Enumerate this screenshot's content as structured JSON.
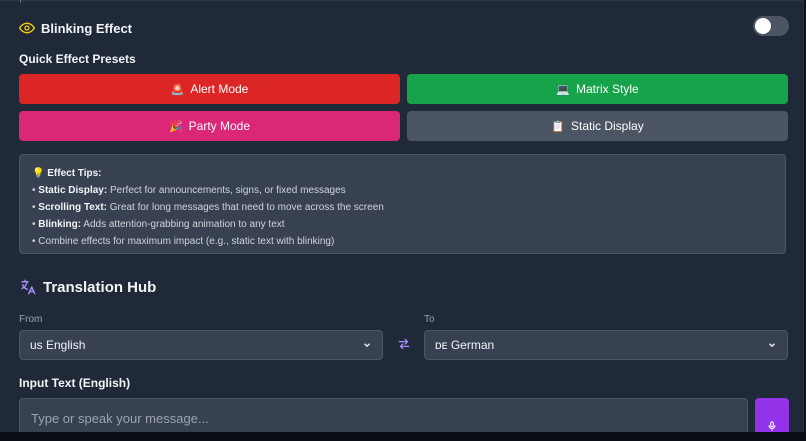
{
  "blink": {
    "title": "Blinking Effect",
    "enabled": false
  },
  "presets": {
    "label": "Quick Effect Presets",
    "items": [
      {
        "label": "Alert Mode",
        "icon": "🚨",
        "color": "#dc2626"
      },
      {
        "label": "Matrix Style",
        "icon": "💻",
        "color": "#16a34a"
      },
      {
        "label": "Party Mode",
        "icon": "🎉",
        "color": "#db2777"
      },
      {
        "label": "Static Display",
        "icon": "📋",
        "color": "#4b5563"
      }
    ]
  },
  "tips": {
    "heading": "Effect Tips:",
    "icon": "💡",
    "items": [
      {
        "bold": "Static Display:",
        "text": " Perfect for announcements, signs, or fixed messages"
      },
      {
        "bold": "Scrolling Text:",
        "text": " Great for long messages that need to move across the screen"
      },
      {
        "bold": "Blinking:",
        "text": " Adds attention-grabbing animation to any text"
      },
      {
        "bold": "",
        "text": "Combine effects for maximum impact (e.g., static text with blinking)"
      }
    ]
  },
  "translation": {
    "title": "Translation Hub",
    "from_label": "From",
    "to_label": "To",
    "from_value": "us English",
    "to_value": "ᴅᴇ German",
    "input_label": "Input Text (English)",
    "input_placeholder": "Type or speak your message..."
  },
  "colors": {
    "accent_purple": "#9333ea",
    "eye_yellow": "#facc15",
    "swap_purple": "#a78bfa"
  }
}
